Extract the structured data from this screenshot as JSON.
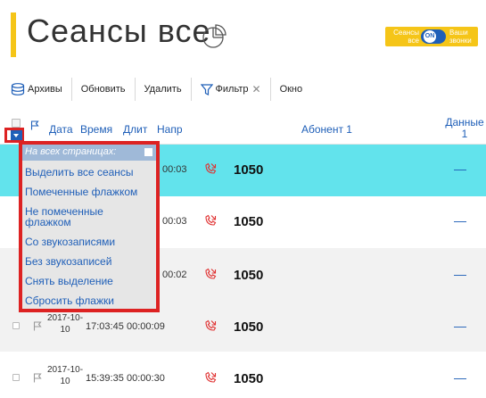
{
  "header": {
    "title": "Сеансы все",
    "toggle": {
      "left_line1": "Сеансы",
      "left_line2": "все",
      "state": "ON",
      "right_line1": "Ваши",
      "right_line2": "звонки"
    }
  },
  "toolbar": {
    "archive_label": "Архивы",
    "refresh_label": "Обновить",
    "delete_label": "Удалить",
    "filter_label": "Фильтр",
    "window_label": "Окно"
  },
  "table": {
    "columns": {
      "date": "Дата",
      "time": "Время",
      "duration": "Длит",
      "direction": "Напр",
      "subscriber": "Абонент 1",
      "data1_line1": "Данные",
      "data1_line2": "1"
    },
    "rows": [
      {
        "date_l1": "",
        "date_l2": "",
        "time": "",
        "duration": "00:03",
        "subscriber": "1050",
        "data1": "—"
      },
      {
        "date_l1": "",
        "date_l2": "",
        "time": "",
        "duration": "00:03",
        "subscriber": "1050",
        "data1": "—"
      },
      {
        "date_l1": "",
        "date_l2": "",
        "time": "",
        "duration": "00:02",
        "subscriber": "1050",
        "data1": "—"
      },
      {
        "date_l1": "2017-10-",
        "date_l2": "10",
        "time": "17:03:45",
        "duration": "00:00:09",
        "subscriber": "1050",
        "data1": "—"
      },
      {
        "date_l1": "2017-10-",
        "date_l2": "10",
        "time": "15:39:35",
        "duration": "00:00:30",
        "subscriber": "1050",
        "data1": "—"
      }
    ]
  },
  "dropdown": {
    "header": "На всех страницах:",
    "items": [
      "Выделить все сеансы",
      "Помеченные флажком",
      "Не помеченные",
      "флажком",
      "Со звукозаписями",
      "Без звукозаписей",
      "Снять выделение",
      "Сбросить флажки"
    ]
  },
  "colors": {
    "accent": "#f5c518",
    "link": "#1f5fb8",
    "selected_row": "#62e3ec",
    "highlight": "#dd2222",
    "phone_icon": "#e03030"
  }
}
